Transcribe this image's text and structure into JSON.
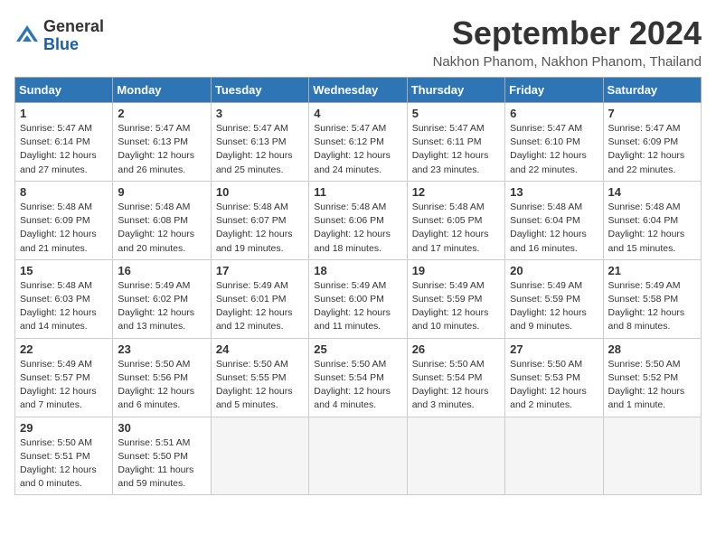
{
  "header": {
    "logo_general": "General",
    "logo_blue": "Blue",
    "month_title": "September 2024",
    "subtitle": "Nakhon Phanom, Nakhon Phanom, Thailand"
  },
  "weekdays": [
    "Sunday",
    "Monday",
    "Tuesday",
    "Wednesday",
    "Thursday",
    "Friday",
    "Saturday"
  ],
  "weeks": [
    [
      {
        "day": "1",
        "sunrise": "5:47 AM",
        "sunset": "6:14 PM",
        "daylight": "12 hours and 27 minutes."
      },
      {
        "day": "2",
        "sunrise": "5:47 AM",
        "sunset": "6:13 PM",
        "daylight": "12 hours and 26 minutes."
      },
      {
        "day": "3",
        "sunrise": "5:47 AM",
        "sunset": "6:13 PM",
        "daylight": "12 hours and 25 minutes."
      },
      {
        "day": "4",
        "sunrise": "5:47 AM",
        "sunset": "6:12 PM",
        "daylight": "12 hours and 24 minutes."
      },
      {
        "day": "5",
        "sunrise": "5:47 AM",
        "sunset": "6:11 PM",
        "daylight": "12 hours and 23 minutes."
      },
      {
        "day": "6",
        "sunrise": "5:47 AM",
        "sunset": "6:10 PM",
        "daylight": "12 hours and 22 minutes."
      },
      {
        "day": "7",
        "sunrise": "5:47 AM",
        "sunset": "6:09 PM",
        "daylight": "12 hours and 22 minutes."
      }
    ],
    [
      {
        "day": "8",
        "sunrise": "5:48 AM",
        "sunset": "6:09 PM",
        "daylight": "12 hours and 21 minutes."
      },
      {
        "day": "9",
        "sunrise": "5:48 AM",
        "sunset": "6:08 PM",
        "daylight": "12 hours and 20 minutes."
      },
      {
        "day": "10",
        "sunrise": "5:48 AM",
        "sunset": "6:07 PM",
        "daylight": "12 hours and 19 minutes."
      },
      {
        "day": "11",
        "sunrise": "5:48 AM",
        "sunset": "6:06 PM",
        "daylight": "12 hours and 18 minutes."
      },
      {
        "day": "12",
        "sunrise": "5:48 AM",
        "sunset": "6:05 PM",
        "daylight": "12 hours and 17 minutes."
      },
      {
        "day": "13",
        "sunrise": "5:48 AM",
        "sunset": "6:04 PM",
        "daylight": "12 hours and 16 minutes."
      },
      {
        "day": "14",
        "sunrise": "5:48 AM",
        "sunset": "6:04 PM",
        "daylight": "12 hours and 15 minutes."
      }
    ],
    [
      {
        "day": "15",
        "sunrise": "5:48 AM",
        "sunset": "6:03 PM",
        "daylight": "12 hours and 14 minutes."
      },
      {
        "day": "16",
        "sunrise": "5:49 AM",
        "sunset": "6:02 PM",
        "daylight": "12 hours and 13 minutes."
      },
      {
        "day": "17",
        "sunrise": "5:49 AM",
        "sunset": "6:01 PM",
        "daylight": "12 hours and 12 minutes."
      },
      {
        "day": "18",
        "sunrise": "5:49 AM",
        "sunset": "6:00 PM",
        "daylight": "12 hours and 11 minutes."
      },
      {
        "day": "19",
        "sunrise": "5:49 AM",
        "sunset": "5:59 PM",
        "daylight": "12 hours and 10 minutes."
      },
      {
        "day": "20",
        "sunrise": "5:49 AM",
        "sunset": "5:59 PM",
        "daylight": "12 hours and 9 minutes."
      },
      {
        "day": "21",
        "sunrise": "5:49 AM",
        "sunset": "5:58 PM",
        "daylight": "12 hours and 8 minutes."
      }
    ],
    [
      {
        "day": "22",
        "sunrise": "5:49 AM",
        "sunset": "5:57 PM",
        "daylight": "12 hours and 7 minutes."
      },
      {
        "day": "23",
        "sunrise": "5:50 AM",
        "sunset": "5:56 PM",
        "daylight": "12 hours and 6 minutes."
      },
      {
        "day": "24",
        "sunrise": "5:50 AM",
        "sunset": "5:55 PM",
        "daylight": "12 hours and 5 minutes."
      },
      {
        "day": "25",
        "sunrise": "5:50 AM",
        "sunset": "5:54 PM",
        "daylight": "12 hours and 4 minutes."
      },
      {
        "day": "26",
        "sunrise": "5:50 AM",
        "sunset": "5:54 PM",
        "daylight": "12 hours and 3 minutes."
      },
      {
        "day": "27",
        "sunrise": "5:50 AM",
        "sunset": "5:53 PM",
        "daylight": "12 hours and 2 minutes."
      },
      {
        "day": "28",
        "sunrise": "5:50 AM",
        "sunset": "5:52 PM",
        "daylight": "12 hours and 1 minute."
      }
    ],
    [
      {
        "day": "29",
        "sunrise": "5:50 AM",
        "sunset": "5:51 PM",
        "daylight": "12 hours and 0 minutes."
      },
      {
        "day": "30",
        "sunrise": "5:51 AM",
        "sunset": "5:50 PM",
        "daylight": "11 hours and 59 minutes."
      },
      null,
      null,
      null,
      null,
      null
    ]
  ]
}
